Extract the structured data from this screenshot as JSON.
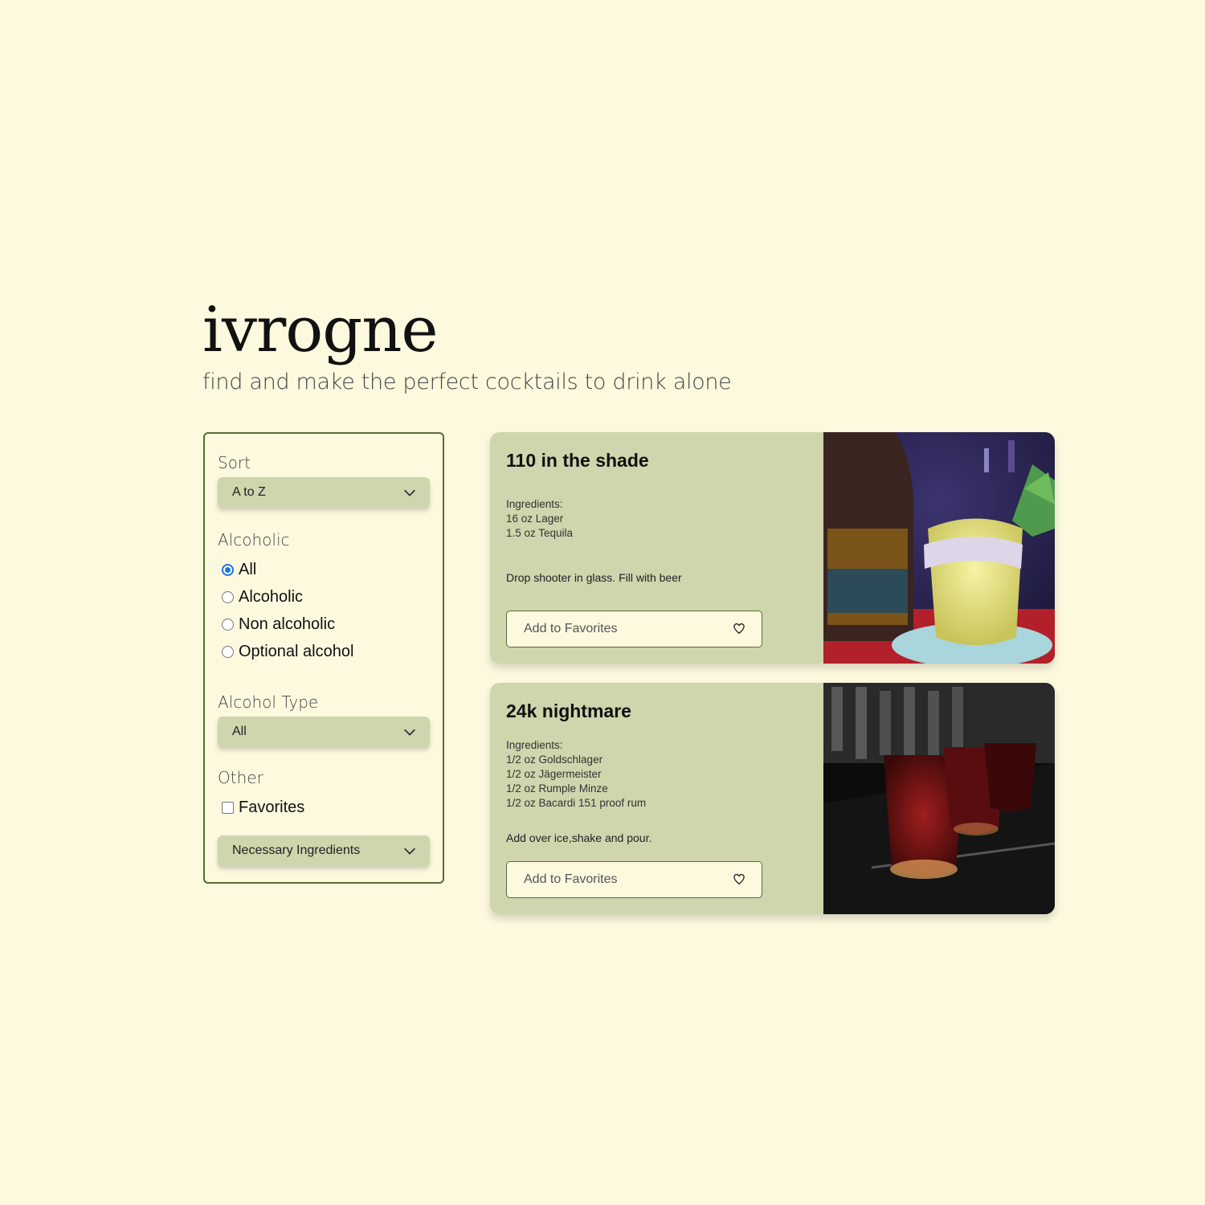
{
  "header": {
    "brand": "ivrogne",
    "tagline": "find and make the perfect cocktails to drink alone"
  },
  "filters": {
    "sort": {
      "label": "Sort",
      "selected": "A to Z"
    },
    "alcoholic": {
      "label": "Alcoholic",
      "options": [
        "All",
        "Alcoholic",
        "Non alcoholic",
        "Optional alcohol"
      ],
      "selected": "All"
    },
    "alcohol_type": {
      "label": "Alcohol Type",
      "selected": "All"
    },
    "other": {
      "label": "Other",
      "favorites_label": "Favorites",
      "favorites_checked": false,
      "ingredients_selected": "Necessary Ingredients"
    }
  },
  "cards": [
    {
      "title": "110 in the shade",
      "ingredients_label": "Ingredients:",
      "ingredients": [
        "16 oz Lager",
        "1.5 oz Tequila"
      ],
      "instructions": "Drop shooter in glass. Fill with beer",
      "fav_label": "Add to Favorites"
    },
    {
      "title": "24k nightmare",
      "ingredients_label": "Ingredients:",
      "ingredients": [
        "1/2 oz Goldschlager",
        "1/2 oz Jägermeister",
        "1/2 oz Rumple Minze",
        "1/2 oz Bacardi 151 proof rum"
      ],
      "instructions": "Add over ice,shake and pour.",
      "fav_label": "Add to Favorites"
    }
  ],
  "colors": {
    "background": "#fdf9df",
    "card": "#cfd5ad",
    "border": "#5b6b34",
    "radio_accent": "#1a73e8"
  }
}
